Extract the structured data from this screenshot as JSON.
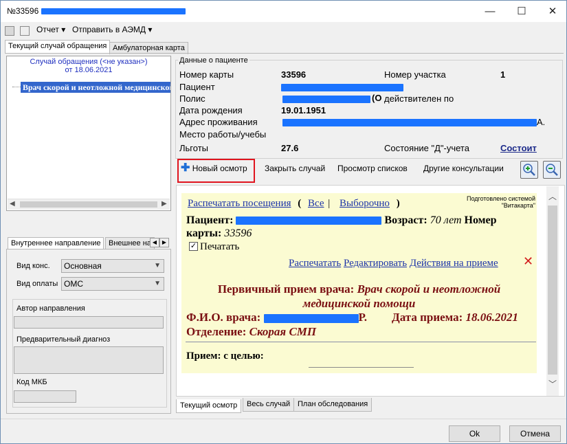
{
  "window": {
    "title": "№33596",
    "minimize": "—",
    "maximize": "☐",
    "close": "✕"
  },
  "toolbar": {
    "report": "Отчет ▾",
    "send": "Отправить в АЭМД ▾"
  },
  "main_tabs": [
    "Текущий случай обращения",
    "Амбулаторная карта"
  ],
  "tree": {
    "header_line1": "Случай обращения (<не указан>)",
    "header_line2": "от 18.06.2021",
    "node": "Врач скорой и неотложной медицинской помощи"
  },
  "left_tabs": [
    "Внутреннее направление",
    "Внешнее на"
  ],
  "left_form": {
    "consult_type_label": "Вид конс.",
    "consult_type_value": "Основная",
    "payment_type_label": "Вид оплаты",
    "payment_type_value": "ОМС",
    "author_label": "Автор направления",
    "prelim_diag_label": "Предварительный диагноз",
    "mkb_label": "Код МКБ"
  },
  "patient": {
    "section_title": "Данные о пациенте",
    "card_label": "Номер карты",
    "card_value": "33596",
    "district_label": "Номер участка",
    "district_value": "1",
    "patient_label": "Пациент",
    "policy_label": "Полис",
    "policy_tail": "(O",
    "policy_valid": "действителен по",
    "dob_label": "Дата рождения",
    "dob_value": "19.01.1951",
    "address_label": "Адрес проживания",
    "address_tail": "А.",
    "work_label": "Место работы/учебы",
    "benefits_label": "Льготы",
    "benefits_value": "27.6",
    "d_status_label": "Состояние \"Д\"-учета",
    "d_status_value": "Состоит"
  },
  "actions": {
    "new_exam": "Новый осмотр",
    "close_case": "Закрыть случай",
    "view_lists": "Просмотр списков",
    "other_consults": "Другие консультации"
  },
  "doc": {
    "print_visits": "Распечатать посещения",
    "paren_open": "(",
    "all": "Все",
    "sep": "|",
    "selective": "Выборочно",
    "paren_close": ")",
    "prepared_line1": "Подготовлено системой",
    "prepared_line2": "\"Витакарта\"",
    "patient_label": "Пациент:",
    "age_label": "Возраст:",
    "age_value": "70 лет",
    "card_label_1": "Номер",
    "card_label_2": "карты:",
    "card_value": "33596",
    "print_label": "Печатать",
    "print_link": "Распечатать",
    "edit_link": "Редактировать",
    "actions_link": "Действия на приеме",
    "exam_title": "Первичный прием врача:",
    "exam_specialty_1": "Врач скорой и неотложной",
    "exam_specialty_2": "медицинской помощи",
    "doctor_label": "Ф.И.О. врача:",
    "doctor_tail": "Р.",
    "date_label": "Дата приема:",
    "date_value": "18.06.2021",
    "dept_label": "Отделение:",
    "dept_value": "Скорая СМП",
    "goal_label": "Прием: с целью:"
  },
  "bottom_tabs": [
    "Текущий осмотр",
    "Весь случай",
    "План обследования"
  ],
  "buttons": {
    "ok": "Ok",
    "cancel": "Отмена"
  }
}
